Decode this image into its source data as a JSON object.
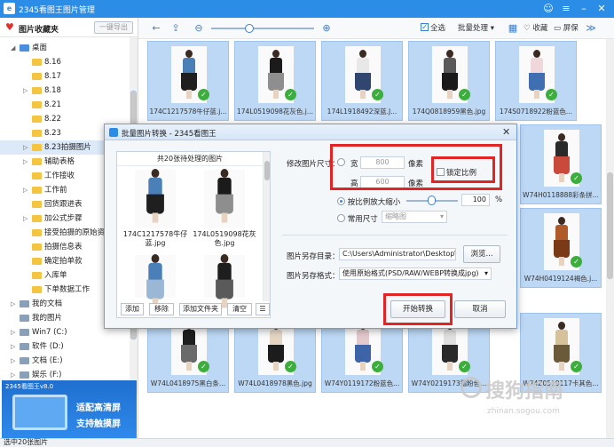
{
  "app": {
    "title": "2345看图王图片管理",
    "logo": "2345-logo-icon"
  },
  "sidebar": {
    "header_label": "图片收藏夹",
    "export_button": "一键导出",
    "tree": [
      {
        "label": "桌面",
        "level": 1,
        "expanded": true,
        "icon": "blue"
      },
      {
        "label": "8.16",
        "level": 2
      },
      {
        "label": "8.17",
        "level": 2
      },
      {
        "label": "8.18",
        "level": 2,
        "arrow": true
      },
      {
        "label": "8.21",
        "level": 2
      },
      {
        "label": "8.22",
        "level": 2
      },
      {
        "label": "8.23",
        "level": 2
      },
      {
        "label": "8.23拍摄图片",
        "level": 2,
        "arrow": true,
        "selected": true
      },
      {
        "label": "辅助表格",
        "level": 2,
        "arrow": true
      },
      {
        "label": "工作接收",
        "level": 2
      },
      {
        "label": "工作前",
        "level": 2,
        "arrow": true
      },
      {
        "label": "回货跟进表",
        "level": 2
      },
      {
        "label": "加公式步骤",
        "level": 2,
        "arrow": true
      },
      {
        "label": "接受拍摄的原始资料",
        "level": 2
      },
      {
        "label": "拍摄信息表",
        "level": 2
      },
      {
        "label": "确定拍单款",
        "level": 2
      },
      {
        "label": "入库单",
        "level": 2
      },
      {
        "label": "下单数据工作",
        "level": 2
      },
      {
        "label": "我的文档",
        "level": 1,
        "arrow": true,
        "icon": "gray"
      },
      {
        "label": "我的图片",
        "level": 1,
        "icon": "gray"
      },
      {
        "label": "Win7 (C:)",
        "level": 1,
        "arrow": true,
        "icon": "gray"
      },
      {
        "label": "软件 (D:)",
        "level": 1,
        "arrow": true,
        "icon": "gray"
      },
      {
        "label": "文档 (E:)",
        "level": 1,
        "arrow": true,
        "icon": "gray"
      },
      {
        "label": "娱乐 (F:)",
        "level": 1,
        "arrow": true,
        "icon": "gray"
      }
    ],
    "ad": {
      "version": "2345看图王v8.0",
      "line1": "适配高清屏",
      "line2": "支持触摸屏"
    }
  },
  "toolbar": {
    "select_all": "全选",
    "batch": "批量处理",
    "favorite": "收藏",
    "fullscreen": "屏保"
  },
  "thumbs": [
    {
      "caption": "174C1217578牛仔蓝.j...",
      "top": "#4a7fb8",
      "bottom": "#1f1f1f"
    },
    {
      "caption": "174L0519098花灰色.j...",
      "top": "#1b1b1b",
      "bottom": "#8e8e8e"
    },
    {
      "caption": "174L1918492深蓝.J...",
      "top": "#e8e8e8",
      "bottom": "#30466e"
    },
    {
      "caption": "174Q0818959黑色.jpg",
      "top": "#5a5a5a",
      "bottom": "#1a1a1a"
    },
    {
      "caption": "174S0718922粉蓝色...",
      "top": "#f0d7dc",
      "bottom": "#3f6fb0"
    },
    {
      "caption": "W74H0118888彩条拼...",
      "top": "#2a2a2a",
      "bottom": "#c94a3a"
    },
    {
      "caption": "W74H0419124褐色.j...",
      "top": "#b05a2a",
      "bottom": "#7a3a18"
    },
    {
      "caption": "W74L0418975黑白条...",
      "top": "#1e1e1e",
      "bottom": "#6a6a6a"
    },
    {
      "caption": "W74L0418978黑色.jpg",
      "top": "#e5d6c4",
      "bottom": "#1c1c1c"
    },
    {
      "caption": "W74Y0119172粉蓝色...",
      "top": "#e4c9cf",
      "bottom": "#3d64a6"
    },
    {
      "caption": "W74Y0219173霜粉色...",
      "top": "#e0e0e0",
      "bottom": "#2a2a2a"
    },
    {
      "caption": "W74Z0519117卡其色...",
      "top": "#d6c29a",
      "bottom": "#6b5a3a"
    }
  ],
  "dialog": {
    "title": "批量图片转换 - 2345看图王",
    "list_header": "共20张待处理的图片",
    "list_items": [
      {
        "caption": "174C1217578牛仔\n蓝.jpg",
        "top": "#4a7fb8",
        "bottom": "#1f1f1f"
      },
      {
        "caption": "174L0519098花灰\n色.jpg",
        "top": "#1b1b1b",
        "bottom": "#8e8e8e"
      },
      {
        "caption": "",
        "top": "#4a7fb8",
        "bottom": "#9bb7d6"
      },
      {
        "caption": "",
        "top": "#1e1e1e",
        "bottom": "#5a5a5a"
      }
    ],
    "btn_add": "添加",
    "btn_remove": "移除",
    "btn_add_folder": "添加文件夹",
    "btn_clear": "清空",
    "resize_label": "修改图片尺寸：",
    "width_label": "宽",
    "width_value": "800",
    "height_label": "高",
    "height_value": "600",
    "unit_px": "像素",
    "lock_ratio": "锁定比例",
    "scale_label": "按比例放大缩小",
    "scale_value": "100",
    "percent": "%",
    "common_size_label": "常用尺寸",
    "common_size_value": "缩略图",
    "save_dir_label": "图片另存目录：",
    "save_dir_value": "C:\\Users\\Administrator\\Desktop\\",
    "browse": "浏览...",
    "save_format_label": "图片另存格式：",
    "save_format_value": "使用原始格式(PSD/RAW/WEBP转换成jpg)",
    "start": "开始转换",
    "cancel": "取消"
  },
  "status": {
    "text": "选中20张图片"
  },
  "watermark": {
    "main": "搜狗指南",
    "url": "zhinan.sogou.com"
  }
}
